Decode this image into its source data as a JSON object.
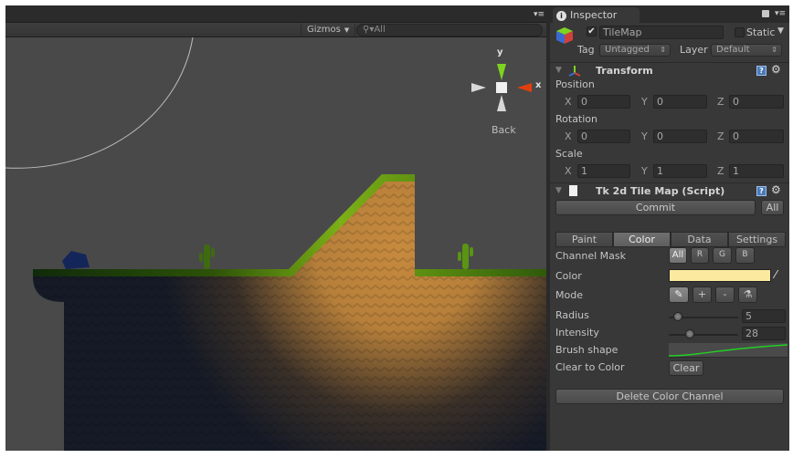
{
  "scene": {
    "gizmos_label": "Gizmos",
    "search_placeholder": "All",
    "orientation": {
      "y_label": "y",
      "x_label": "x",
      "view_label": "Back"
    }
  },
  "inspector": {
    "tab_label": "Inspector",
    "object": {
      "active": true,
      "name": "TileMap",
      "static_label": "Static",
      "static": false,
      "tag_label": "Tag",
      "tag_value": "Untagged",
      "layer_label": "Layer",
      "layer_value": "Default"
    },
    "transform": {
      "title": "Transform",
      "position": {
        "label": "Position",
        "x": "0",
        "y": "0",
        "z": "0"
      },
      "rotation": {
        "label": "Rotation",
        "x": "0",
        "y": "0",
        "z": "0"
      },
      "scale": {
        "label": "Scale",
        "x": "1",
        "y": "1",
        "z": "1"
      },
      "axes": {
        "x": "X",
        "y": "Y",
        "z": "Z"
      }
    },
    "script": {
      "title": "Tk 2d Tile Map (Script)",
      "commit_label": "Commit",
      "all_label": "All",
      "tabs": [
        {
          "label": "Paint",
          "active": false
        },
        {
          "label": "Color",
          "active": true
        },
        {
          "label": "Data",
          "active": false
        },
        {
          "label": "Settings",
          "active": false
        }
      ],
      "channel_mask": {
        "label": "Channel Mask",
        "options": [
          "All",
          "R",
          "G",
          "B"
        ],
        "selected": "All"
      },
      "color": {
        "label": "Color",
        "value": "#fbe9a0"
      },
      "mode": {
        "label": "Mode",
        "options": [
          "pencil-icon",
          "+",
          "-",
          "eyedropper-icon"
        ],
        "selected": "pencil-icon"
      },
      "radius": {
        "label": "Radius",
        "value": "5",
        "slider_fraction": 0.08
      },
      "intensity": {
        "label": "Intensity",
        "value": "28",
        "slider_fraction": 0.28
      },
      "brush_shape_label": "Brush shape",
      "clear_to_color": {
        "label": "Clear to Color",
        "button": "Clear"
      },
      "delete_label": "Delete Color Channel"
    }
  }
}
